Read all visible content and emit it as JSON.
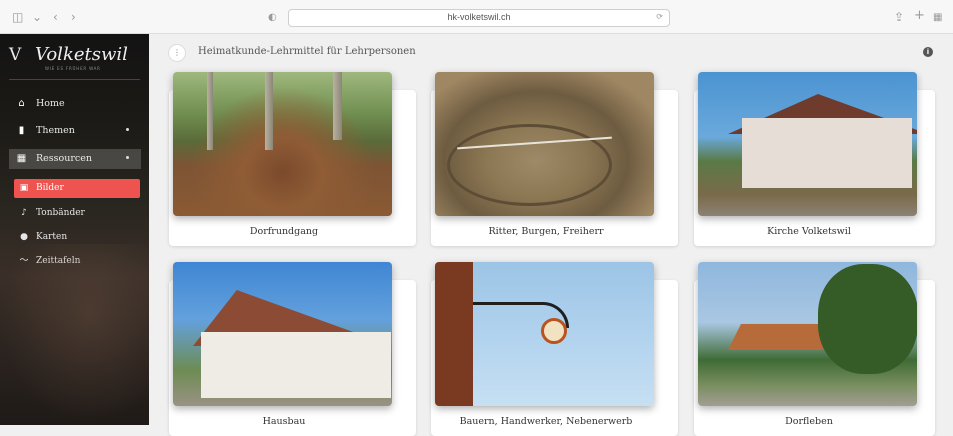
{
  "browser": {
    "url": "hk-volketswil.ch",
    "icons": [
      "sidebar-toggle-icon",
      "chevron-left-icon",
      "chevron-right-icon",
      "shield-icon",
      "translate-icon",
      "reload-icon",
      "share-icon",
      "new-tab-icon",
      "tab-overview-icon"
    ]
  },
  "brand": {
    "letter": "V",
    "name": "Volketswil",
    "subtitle": "WIE ES FRÜHER WAR"
  },
  "sidebar": {
    "items": [
      {
        "label": "Home",
        "icon": "home-icon"
      },
      {
        "label": "Themen",
        "icon": "book-icon"
      },
      {
        "label": "Ressourcen",
        "icon": "grid-icon"
      }
    ],
    "sub_items": [
      {
        "label": "Bilder",
        "icon": "image-icon",
        "active": true
      },
      {
        "label": "Tonbänder",
        "icon": "microphone-icon"
      },
      {
        "label": "Karten",
        "icon": "map-pin-icon"
      },
      {
        "label": "Zeittafeln",
        "icon": "timeline-icon"
      }
    ]
  },
  "header": {
    "title": "Heimatkunde-Lehrmittel für Lehrpersonen",
    "toggle_glyph": "⋮",
    "info_glyph": "i"
  },
  "cards": [
    {
      "caption": "Dorfrundgang"
    },
    {
      "caption": "Ritter, Burgen, Freiherr"
    },
    {
      "caption": "Kirche Volketswil"
    },
    {
      "caption": "Hausbau"
    },
    {
      "caption": "Bauern, Handwerker, Nebenerwerb"
    },
    {
      "caption": "Dorfleben"
    }
  ],
  "colors": {
    "accent": "#ef5350",
    "sidebar": "#1c1a16"
  }
}
